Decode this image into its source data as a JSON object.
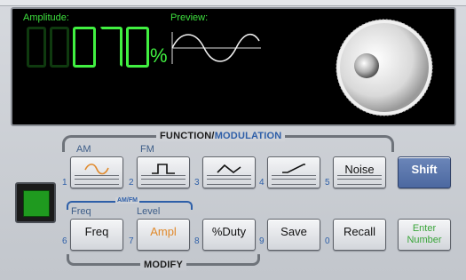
{
  "display": {
    "amplitude_label": "Amplitude:",
    "preview_label": "Preview:",
    "amplitude_value": "070",
    "unit": "%",
    "preview_waveform": "sine"
  },
  "function_section": {
    "title_function": "FUNCTION/",
    "title_modulation": "MODULATION",
    "am_label": "AM",
    "fm_label": "FM",
    "noise_label": "Noise",
    "shift_label": "Shift",
    "numbers": [
      "1",
      "2",
      "3",
      "4",
      "5"
    ]
  },
  "modify_section": {
    "title": "MODIFY",
    "amfm_label": "AM/FM",
    "freq_label": "Freq",
    "level_label": "Level",
    "buttons": [
      "Freq",
      "Ampl",
      "%Duty",
      "Save",
      "Recall"
    ],
    "numbers": [
      "6",
      "7",
      "8",
      "9",
      "0"
    ],
    "enter_line1": "Enter",
    "enter_line2": "Number"
  },
  "colors": {
    "lcd_green": "#41f041",
    "accent_blue": "#2e5fa8",
    "ampl_orange": "#e0892b",
    "shift_blue": "#5671a8"
  }
}
